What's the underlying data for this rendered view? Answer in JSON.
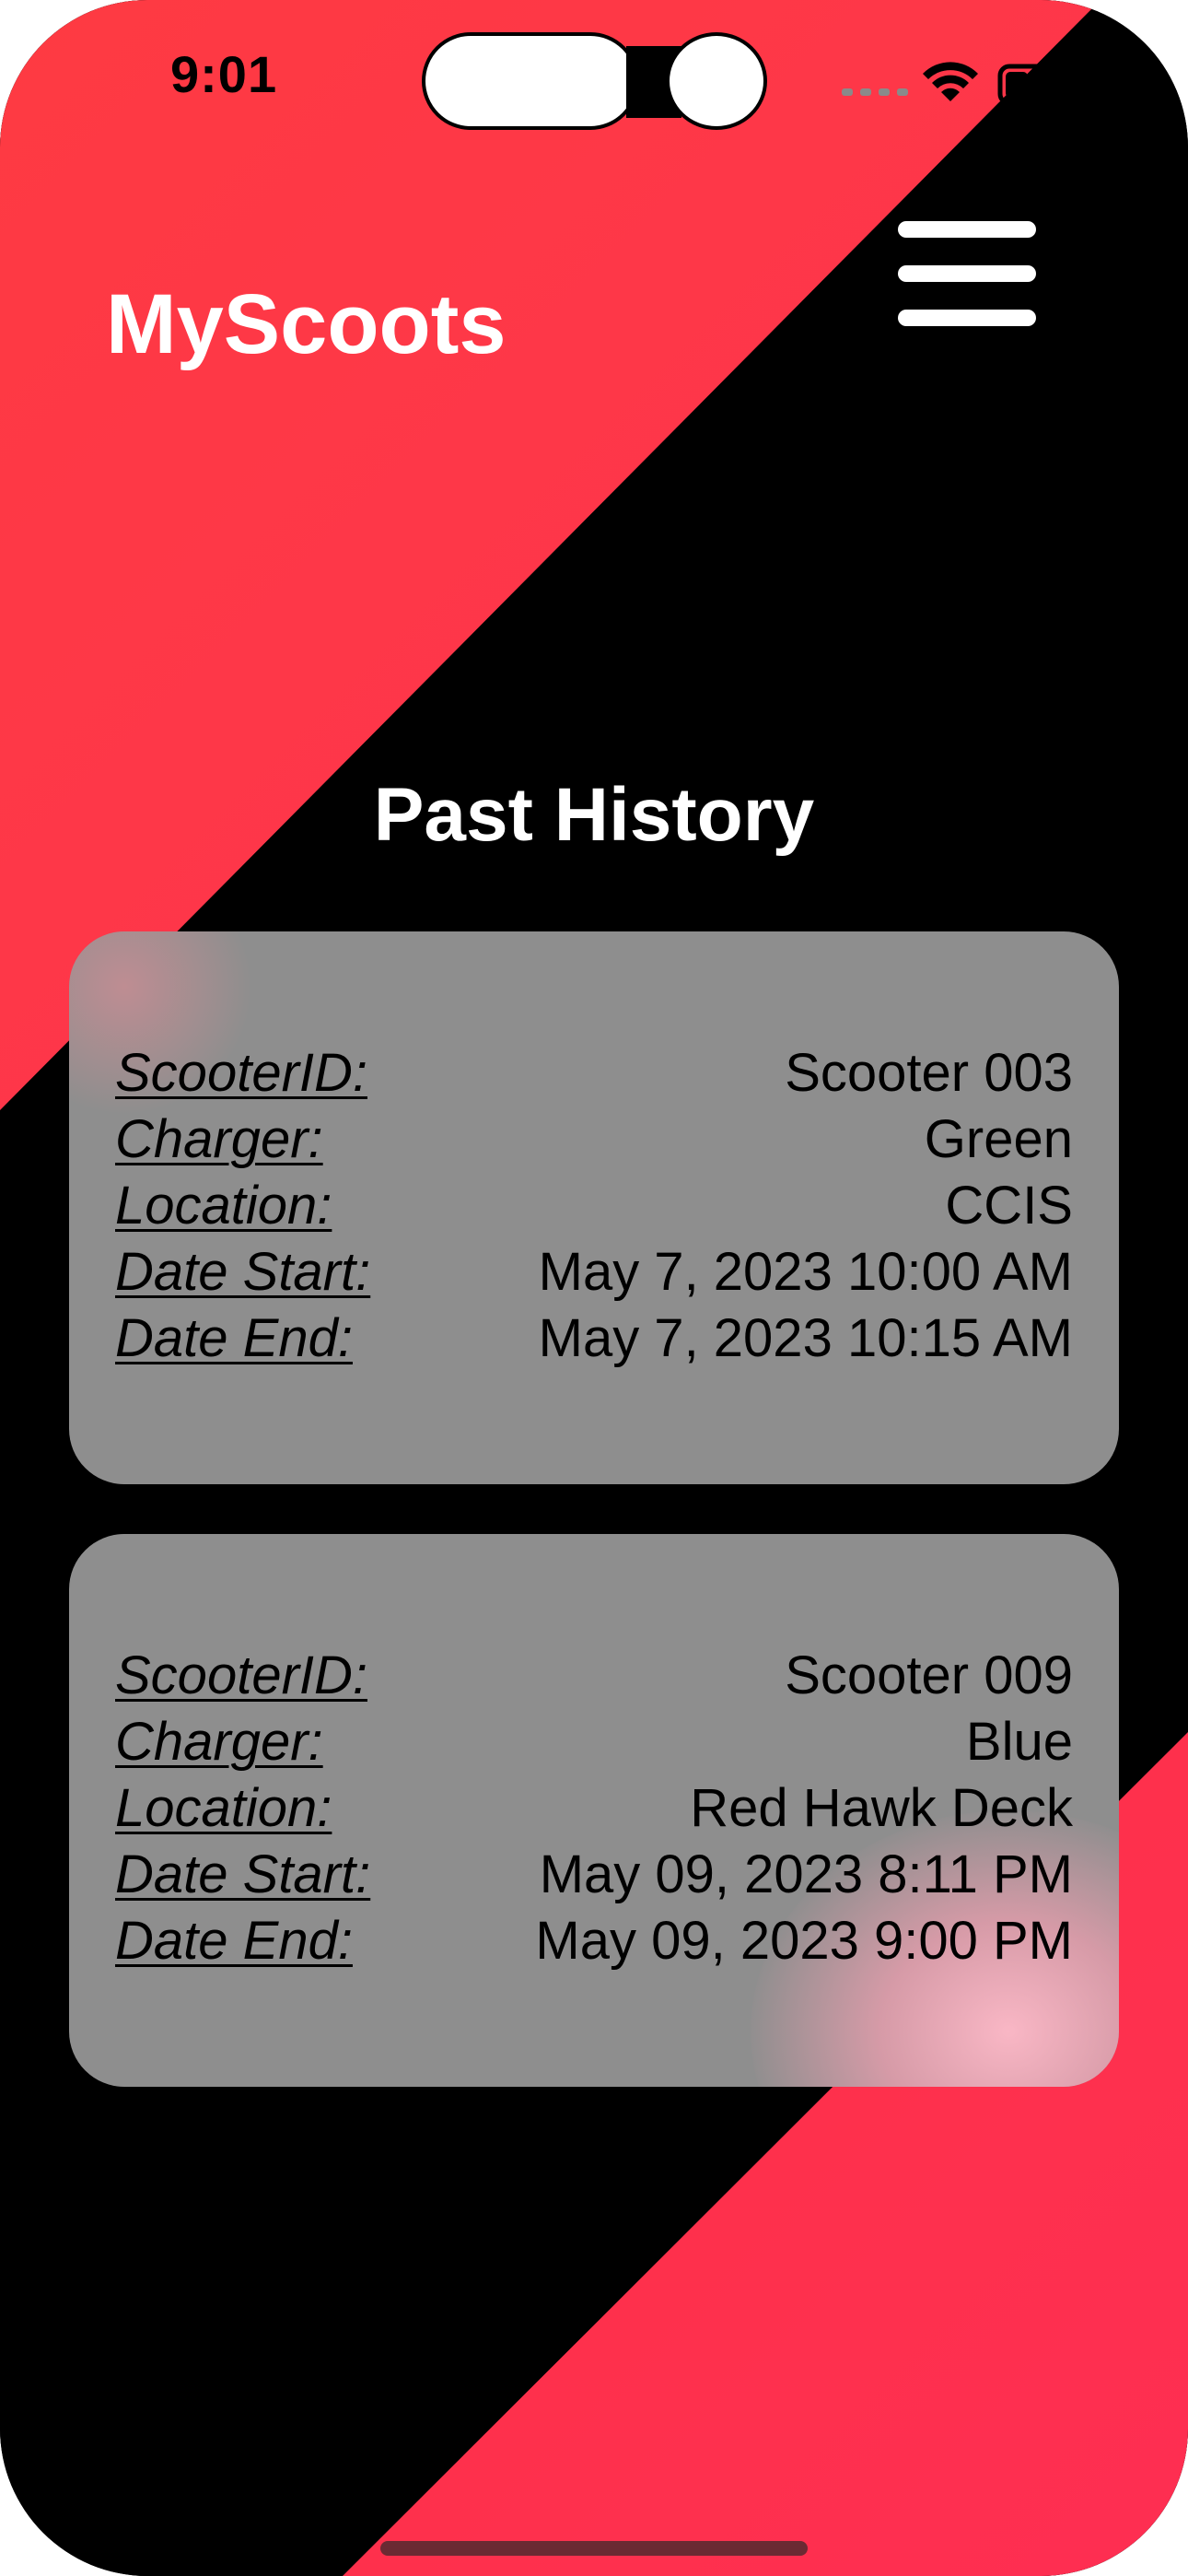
{
  "status_bar": {
    "time": "9:01"
  },
  "header": {
    "app_title": "MyScoots",
    "menu_icon": "hamburger-menu-icon"
  },
  "main": {
    "section_title": "Past History",
    "records": [
      {
        "rows": [
          {
            "label": "ScooterID:",
            "value": "Scooter 003"
          },
          {
            "label": "Charger:",
            "value": "Green"
          },
          {
            "label": "Location:",
            "value": "CCIS"
          },
          {
            "label": "Date Start:",
            "value": "May 7, 2023 10:00 AM"
          },
          {
            "label": "Date End:",
            "value": "May 7, 2023 10:15 AM"
          }
        ]
      },
      {
        "rows": [
          {
            "label": "ScooterID:",
            "value": "Scooter 009"
          },
          {
            "label": "Charger:",
            "value": "Blue"
          },
          {
            "label": "Location:",
            "value": "Red Hawk Deck"
          },
          {
            "label": "Date Start:",
            "value": "May 09, 2023 8:11 PM"
          },
          {
            "label": "Date End:",
            "value": "May 09, 2023 9:00 PM"
          }
        ]
      }
    ]
  },
  "colors": {
    "accent_red": "#fe3548",
    "background": "#000000",
    "card": "#8e8e8e",
    "text_light": "#ffffff",
    "text_dark": "#000000"
  }
}
